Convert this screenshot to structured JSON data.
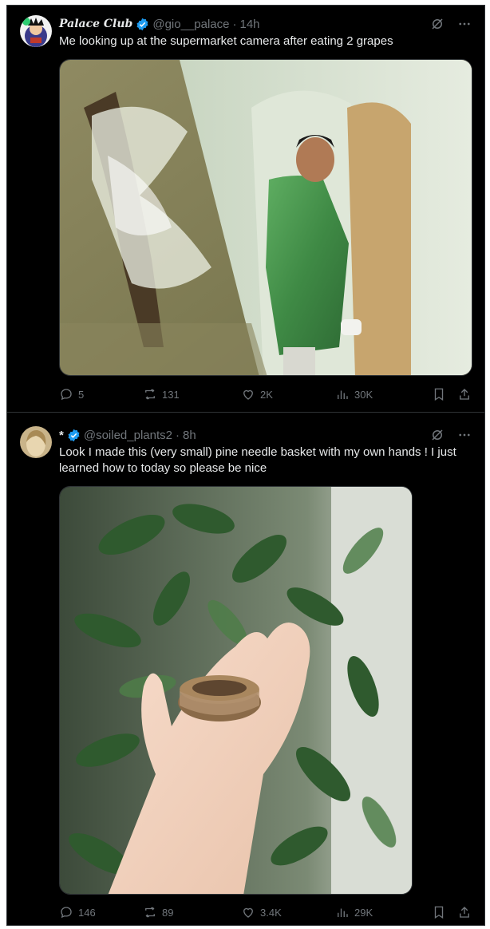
{
  "tweets": [
    {
      "name": "Palace Club",
      "handle": "@gio__palace",
      "time": "14h",
      "text": "Me looking up at the supermarket camera after eating 2 grapes",
      "replies": "5",
      "reposts": "131",
      "likes": "2K",
      "views": "30K"
    },
    {
      "name": "*",
      "handle": "@soiled_plants2",
      "time": "8h",
      "text": "Look I made this (very small) pine needle basket with my own hands ! I just learned how to today so please be nice",
      "replies": "146",
      "reposts": "89",
      "likes": "3.4K",
      "views": "29K"
    }
  ],
  "colors": {
    "background": "#000000",
    "text": "#e7e9ea",
    "muted": "#71767b",
    "verified": "#1d9bf0",
    "border": "#2f3336"
  },
  "icons": [
    "grok-icon",
    "more-icon",
    "reply-icon",
    "repost-icon",
    "like-icon",
    "views-icon",
    "bookmark-icon",
    "share-icon",
    "verified-badge-icon"
  ]
}
